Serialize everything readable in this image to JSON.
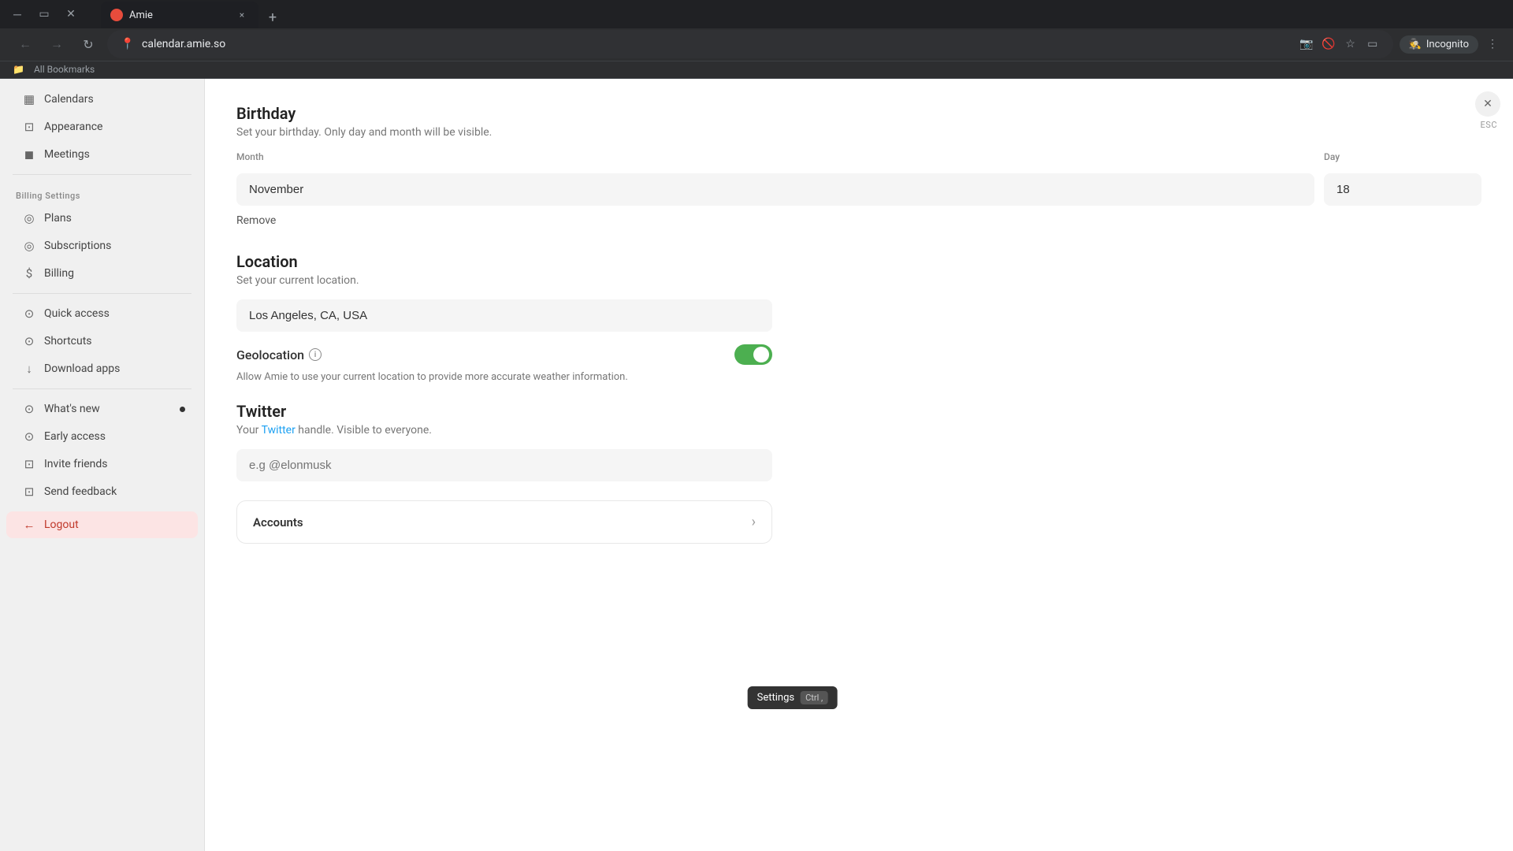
{
  "browser": {
    "tab": {
      "title": "Amie",
      "favicon_color": "#e74c3c",
      "close_label": "×",
      "new_tab_label": "+"
    },
    "address": {
      "url": "calendar.amie.so"
    },
    "profile": {
      "label": "Incognito"
    },
    "bookmarks": {
      "label": "All Bookmarks"
    }
  },
  "sidebar": {
    "sections": {
      "billing_header": "Billing Settings"
    },
    "items": [
      {
        "id": "calendars",
        "label": "Calendars",
        "icon": "▦"
      },
      {
        "id": "appearance",
        "label": "Appearance",
        "icon": "⊡"
      },
      {
        "id": "meetings",
        "label": "Meetings",
        "icon": "◼"
      }
    ],
    "billing_items": [
      {
        "id": "plans",
        "label": "Plans",
        "icon": "◎"
      },
      {
        "id": "subscriptions",
        "label": "Subscriptions",
        "icon": "◎"
      },
      {
        "id": "billing",
        "label": "Billing",
        "icon": "$"
      }
    ],
    "utility_items": [
      {
        "id": "quick-access",
        "label": "Quick access",
        "icon": "⊙"
      },
      {
        "id": "shortcuts",
        "label": "Shortcuts",
        "icon": "⊙"
      },
      {
        "id": "download-apps",
        "label": "Download apps",
        "icon": "↓"
      }
    ],
    "misc_items": [
      {
        "id": "whats-new",
        "label": "What's new",
        "icon": "⊙",
        "has_dot": true
      },
      {
        "id": "early-access",
        "label": "Early access",
        "icon": "⊙"
      },
      {
        "id": "invite-friends",
        "label": "Invite friends",
        "icon": "⊡"
      },
      {
        "id": "send-feedback",
        "label": "Send feedback",
        "icon": "⊡"
      }
    ],
    "logout": {
      "label": "Logout",
      "icon": "←"
    }
  },
  "main": {
    "close_label": "ESC",
    "birthday": {
      "title": "Birthday",
      "description": "Set your birthday. Only day and month will be visible.",
      "month_label": "Month",
      "day_label": "Day",
      "month_value": "November",
      "day_value": "18",
      "remove_label": "Remove"
    },
    "location": {
      "title": "Location",
      "description": "Set your current location.",
      "value": "Los Angeles, CA, USA"
    },
    "geolocation": {
      "title": "Geolocation",
      "description": "Allow Amie to use your current location to provide more accurate weather information.",
      "enabled": true
    },
    "twitter": {
      "title": "Twitter",
      "description_prefix": "Your ",
      "link_text": "Twitter",
      "description_suffix": " handle. Visible to everyone.",
      "placeholder": "e.g @elonmusk"
    },
    "accounts": {
      "title": "Accounts"
    },
    "tooltip": {
      "label": "Settings",
      "shortcut": "Ctrl ,"
    }
  }
}
